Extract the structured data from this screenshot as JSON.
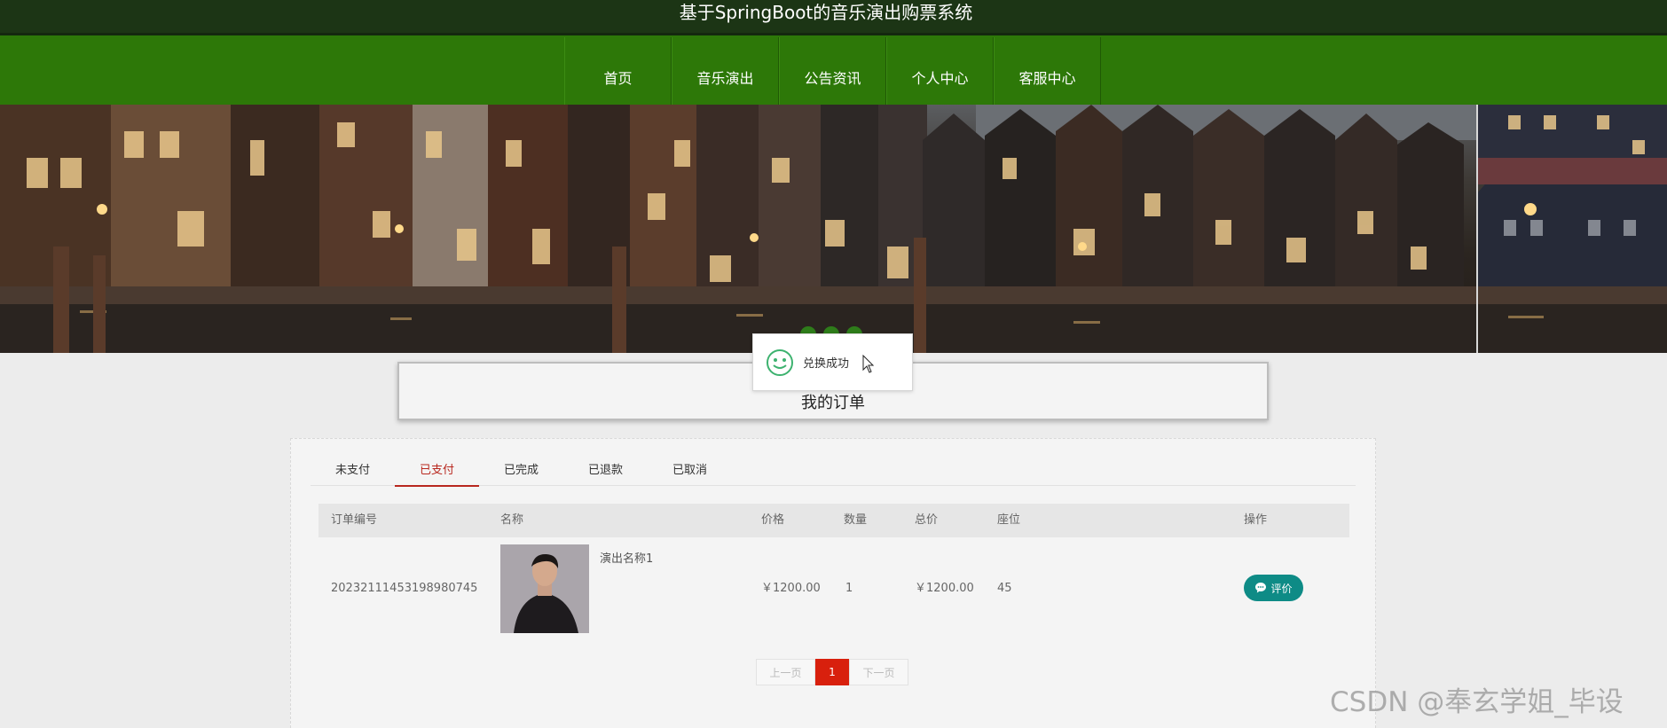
{
  "header": {
    "site_title": "基于SpringBoot的音乐演出购票系统"
  },
  "nav": {
    "items": [
      {
        "label": "首页"
      },
      {
        "label": "音乐演出"
      },
      {
        "label": "公告资讯"
      },
      {
        "label": "个人中心"
      },
      {
        "label": "客服中心"
      }
    ]
  },
  "toast": {
    "message": "兑换成功",
    "icon": "smile-icon"
  },
  "page": {
    "title": "我的订单"
  },
  "tabs": [
    {
      "label": "未支付",
      "active": false
    },
    {
      "label": "已支付",
      "active": true
    },
    {
      "label": "已完成",
      "active": false
    },
    {
      "label": "已退款",
      "active": false
    },
    {
      "label": "已取消",
      "active": false
    }
  ],
  "table": {
    "columns": [
      "订单编号",
      "名称",
      "价格",
      "数量",
      "总价",
      "座位",
      "操作"
    ],
    "rows": [
      {
        "order_no": "20232111453198980745",
        "name": "演出名称1",
        "price": "￥1200.00",
        "quantity": "1",
        "total": "￥1200.00",
        "seat": "45",
        "action_label": "评价"
      }
    ]
  },
  "pagination": {
    "prev_label": "上一页",
    "current_page": "1",
    "next_label": "下一页"
  },
  "watermark": "CSDN @奉玄学姐_毕设",
  "colors": {
    "title_bar": "#1c3515",
    "nav_bar": "#2d7808",
    "active_tab": "#b8271e",
    "review_button": "#0e8b86",
    "current_page": "#d8200d"
  }
}
